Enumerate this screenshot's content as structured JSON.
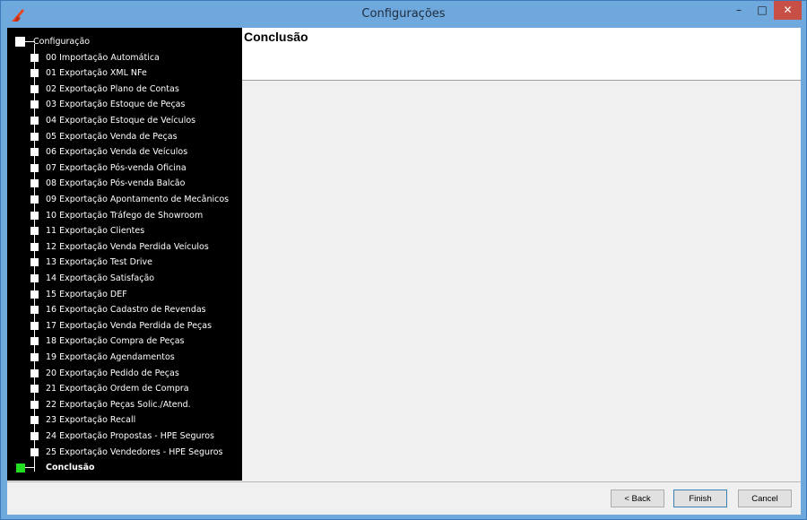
{
  "window": {
    "title": "Configurações",
    "minimize": "–",
    "maximize": "□",
    "close": "✕"
  },
  "tree": {
    "root": "Configuração",
    "items": [
      "00 Importação Automática",
      "01 Exportação XML NFe",
      "02 Exportação Plano de Contas",
      "03 Exportação Estoque de Peças",
      "04 Exportação Estoque de Veículos",
      "05 Exportação Venda de Peças",
      "06 Exportação Venda de Veículos",
      "07 Exportação Pós-venda Oficina",
      "08 Exportação Pós-venda Balcão",
      "09 Exportação Apontamento de Mecânicos",
      "10 Exportação Tráfego de Showroom",
      "11 Exportação Clientes",
      "12 Exportação Venda Perdida Veículos",
      "13 Exportação Test Drive",
      "14 Exportação Satisfação",
      "15 Exportação DEF",
      "16 Exportação Cadastro de Revendas",
      "17 Exportação Venda Perdida de Peças",
      "18 Exportação Compra de Peças",
      "19 Exportação Agendamentos",
      "20 Exportação Pedido de Peças",
      "21 Exportação Ordem de Compra",
      "22 Exportação Peças Solic./Atend.",
      "23 Exportação Recall",
      "24 Exportação Propostas - HPE Seguros",
      "25 Exportação Vendedores - HPE Seguros"
    ],
    "last": "Conclusão",
    "last_color": "#22dd22"
  },
  "header": {
    "title": "Conclusão"
  },
  "buttons": {
    "back": "< Back",
    "finish": "Finish",
    "cancel": "Cancel"
  }
}
